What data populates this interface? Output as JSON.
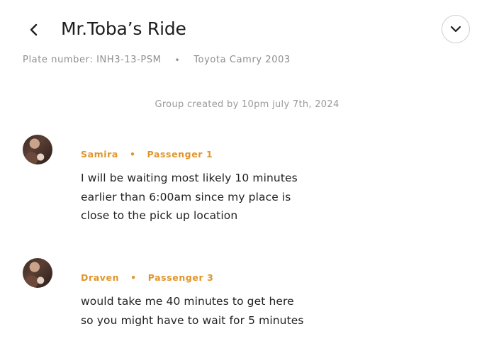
{
  "header": {
    "title": "Mr.Toba’s Ride",
    "plate": "Plate number: INH3-13-PSM",
    "separator": "•",
    "car": "Toyota Camry 2003"
  },
  "group_note": "Group created by 10pm july 7th, 2024",
  "messages": [
    {
      "name": "Samira",
      "separator": "•",
      "role": "Passenger 1",
      "text": "I will be waiting most likely 10 minutes earlier than 6:00am since my place is close to the pick up location"
    },
    {
      "name": "Draven",
      "separator": "•",
      "role": "Passenger 3",
      "text": "would take me 40 minutes to get here so you might have to wait for 5 minutes"
    }
  ],
  "colors": {
    "accent": "#e0952b",
    "muted": "#8e8e8e"
  },
  "icons": {
    "back": "chevron-left-icon",
    "collapse": "chevron-down-icon"
  }
}
